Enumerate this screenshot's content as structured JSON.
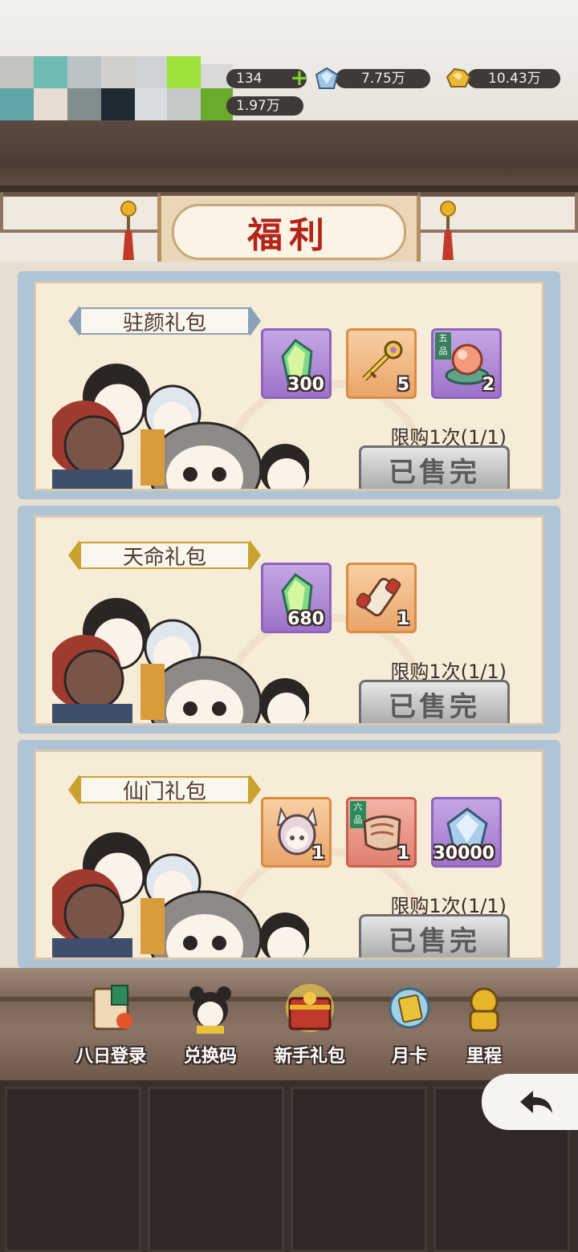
{
  "resources": {
    "stamina": "134",
    "jade": "7.75万",
    "gold": "10.43万",
    "other": "1.97万"
  },
  "title": "福利",
  "packs": [
    {
      "name": "驻颜礼包",
      "items": [
        {
          "icon": "green-crystal-icon",
          "count": "300"
        },
        {
          "icon": "golden-key-icon",
          "count": "5"
        },
        {
          "icon": "pearl-orb-icon",
          "count": "2",
          "tag": "五品"
        }
      ],
      "limit": "限购1次(1/1)",
      "button": "已售完"
    },
    {
      "name": "天命礼包",
      "items": [
        {
          "icon": "green-crystal-icon",
          "count": "680"
        },
        {
          "icon": "scroll-icon",
          "count": "1"
        }
      ],
      "limit": "限购1次(1/1)",
      "button": "已售完"
    },
    {
      "name": "仙门礼包",
      "items": [
        {
          "icon": "fox-girl-portrait-icon",
          "count": "1"
        },
        {
          "icon": "cloth-scroll-icon",
          "count": "1",
          "tag": "六品"
        },
        {
          "icon": "blue-crystal-icon",
          "count": "30000"
        }
      ],
      "limit": "限购1次(1/1)",
      "button": "已售完"
    }
  ],
  "nav": [
    {
      "label": "八日登录",
      "icon": "scroll-bag-icon"
    },
    {
      "label": "兑换码",
      "icon": "girl-avatar-icon"
    },
    {
      "label": "新手礼包",
      "icon": "treasure-chest-icon"
    },
    {
      "label": "月卡",
      "icon": "moon-card-icon"
    },
    {
      "label": "里程",
      "icon": "golden-lion-icon"
    }
  ],
  "colors": {
    "title_red": "#b1251b",
    "card_frame": "#aec3d4",
    "card_bg": "#f7ecd7",
    "label_silver": "#8aa1b8",
    "label_gold": "#c9a12e"
  }
}
